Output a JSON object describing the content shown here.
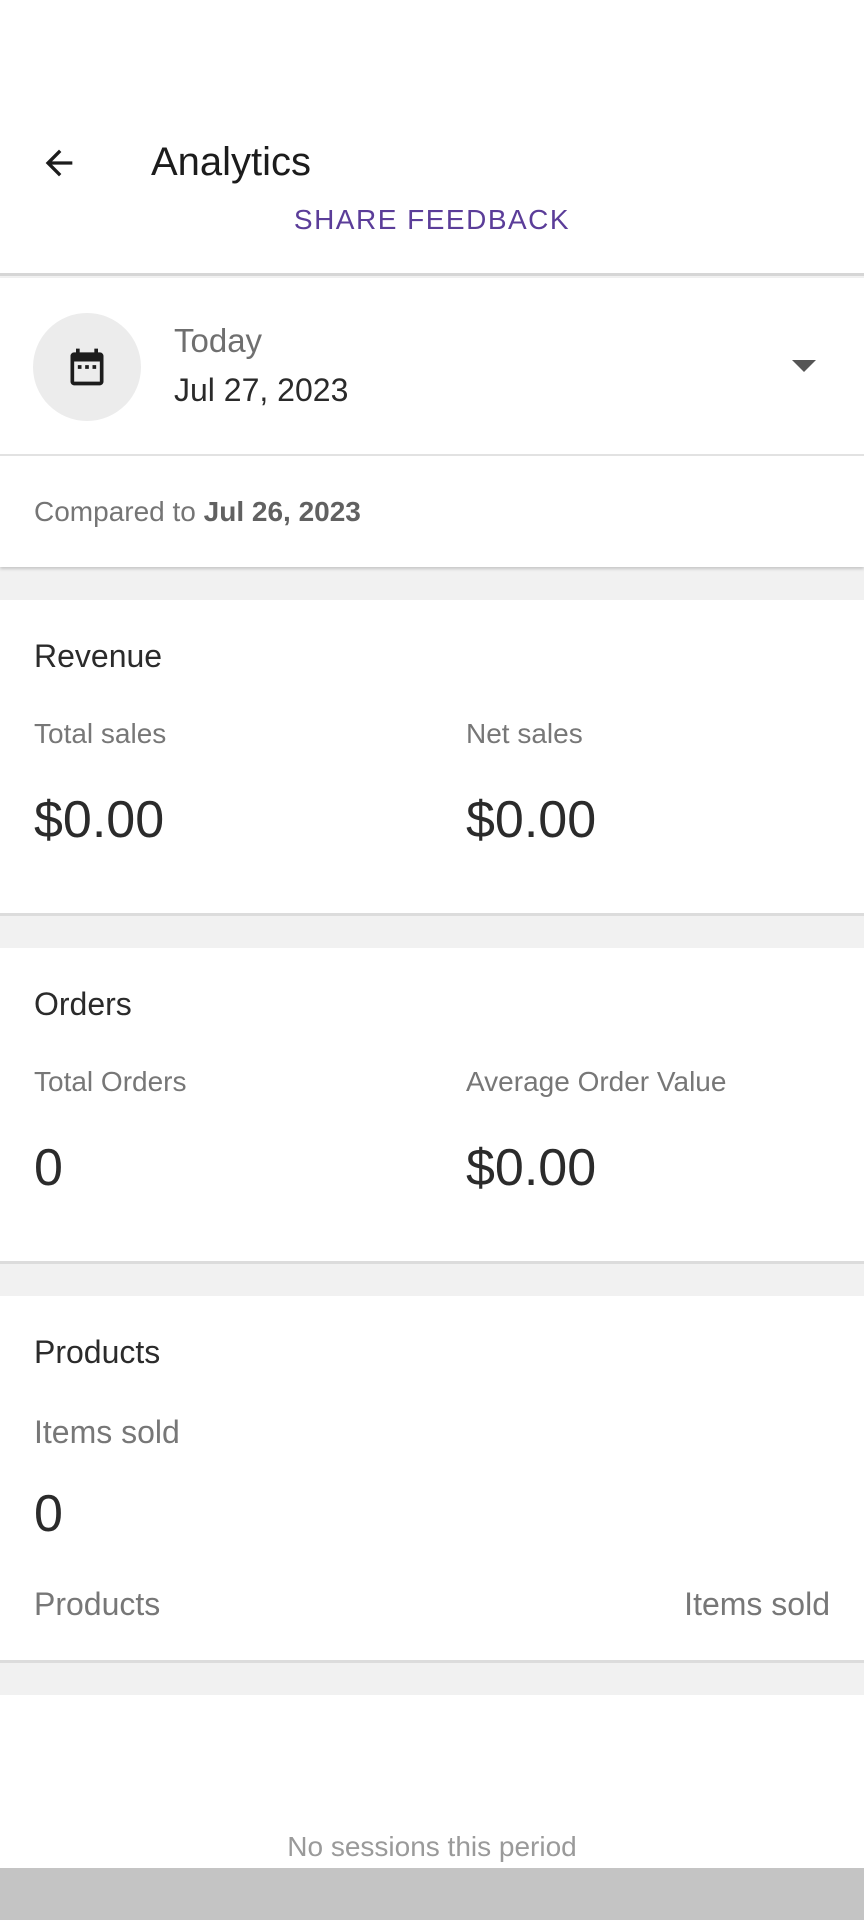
{
  "header": {
    "title": "Analytics",
    "share_feedback": "SHARE FEEDBACK"
  },
  "date_selector": {
    "label": "Today",
    "date": "Jul 27, 2023",
    "compared_prefix": "Compared to",
    "compared_date": "Jul 26, 2023"
  },
  "revenue": {
    "title": "Revenue",
    "total_sales_label": "Total sales",
    "total_sales_value": "$0.00",
    "net_sales_label": "Net sales",
    "net_sales_value": "$0.00"
  },
  "orders": {
    "title": "Orders",
    "total_orders_label": "Total Orders",
    "total_orders_value": "0",
    "avg_order_label": "Average Order Value",
    "avg_order_value": "$0.00"
  },
  "products": {
    "title": "Products",
    "items_sold_label": "Items sold",
    "items_sold_value": "0",
    "col_products": "Products",
    "col_items_sold": "Items sold"
  },
  "sessions": {
    "empty_text": "No sessions this period"
  },
  "icons": {
    "back": "arrow-back-icon",
    "calendar": "calendar-icon",
    "dropdown": "dropdown-arrow-icon"
  },
  "colors": {
    "accent": "#5b3d99",
    "background": "#f1f1f1"
  }
}
